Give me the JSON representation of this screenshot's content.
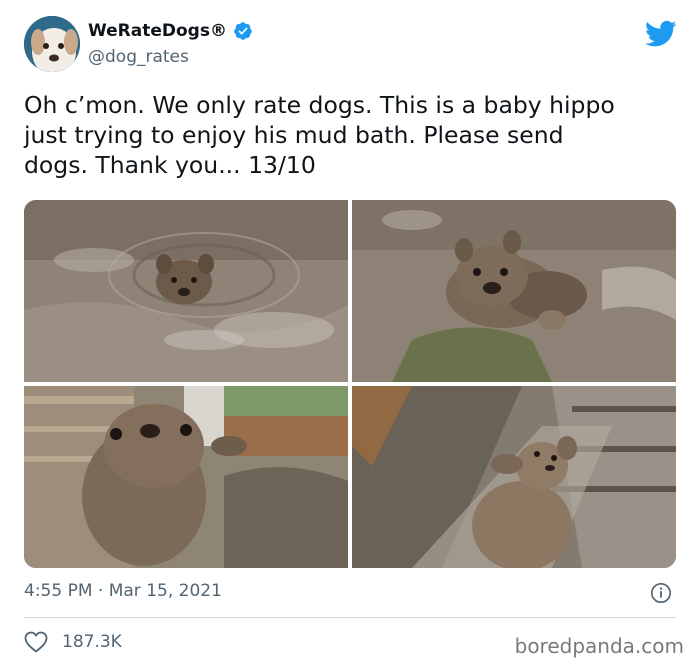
{
  "tweet": {
    "display_name": "WeRateDogs®",
    "handle": "@dog_rates",
    "verified": true,
    "text": "Oh c’mon. We only rate dogs. This is a baby hippo\njust trying to enjoy his mud bath. Please send\ndogs. Thank you... 13/10",
    "photos": [
      {
        "subject": "dog swimming in muddy water"
      },
      {
        "subject": "dog climbing out of mud"
      },
      {
        "subject": "mud-covered dog close-up"
      },
      {
        "subject": "mud-covered dog looking up"
      }
    ],
    "timestamp": "4:55 PM · Mar 15, 2021",
    "likes": "187.3K"
  },
  "watermark": "boredpanda.com",
  "icons": {
    "verified": "verified-badge-icon",
    "twitter": "twitter-bird-icon",
    "info": "info-icon",
    "like": "heart-icon"
  },
  "colors": {
    "accent": "#1d9bf0",
    "text": "#0f1419",
    "secondary": "#536471",
    "divider": "#cfd9de"
  }
}
